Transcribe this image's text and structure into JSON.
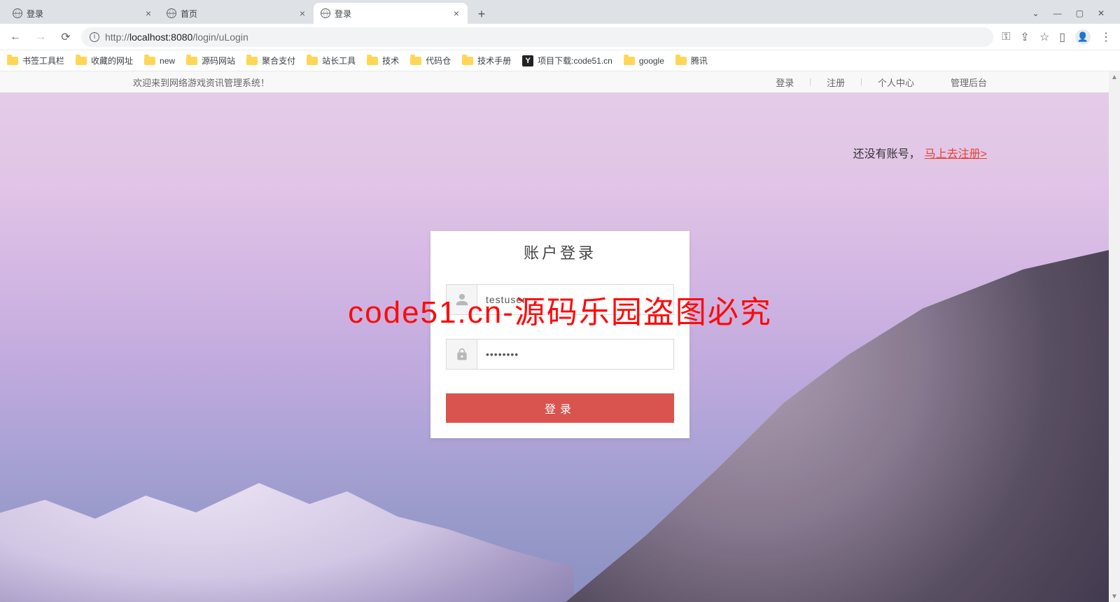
{
  "browser": {
    "tabs": [
      {
        "title": "登录",
        "active": false
      },
      {
        "title": "首页",
        "active": false
      },
      {
        "title": "登录",
        "active": true
      }
    ],
    "url_scheme": "http://",
    "url_hostport": "localhost:8080",
    "url_path": "/login/uLogin",
    "bookmarks": [
      {
        "type": "folder",
        "label": "书签工具栏"
      },
      {
        "type": "folder",
        "label": "收藏的网址"
      },
      {
        "type": "folder",
        "label": "new"
      },
      {
        "type": "folder",
        "label": "源码网站"
      },
      {
        "type": "folder",
        "label": "聚合支付"
      },
      {
        "type": "folder",
        "label": "站长工具"
      },
      {
        "type": "folder",
        "label": "技术"
      },
      {
        "type": "folder",
        "label": "代码仓"
      },
      {
        "type": "folder",
        "label": "技术手册"
      },
      {
        "type": "site",
        "label": "项目下载:code51.cn",
        "icon_letter": "Y"
      },
      {
        "type": "folder",
        "label": "google"
      },
      {
        "type": "folder",
        "label": "腾讯"
      }
    ]
  },
  "site_top": {
    "welcome": "欢迎来到网络游戏资讯管理系统！",
    "links": {
      "login": "登录",
      "register": "注册",
      "profile": "个人中心",
      "admin": "管理后台"
    },
    "divider": "|"
  },
  "register_hint": {
    "prefix": "还没有账号，",
    "link": "马上去注册>"
  },
  "login": {
    "heading": "账户登录",
    "username_value": "testuser",
    "password_value": "••••••••",
    "submit_label": "登录"
  },
  "watermark": "code51.cn-源码乐园盗图必究",
  "colors": {
    "primary_button": "#d9534f",
    "accent_link": "#e74238"
  }
}
